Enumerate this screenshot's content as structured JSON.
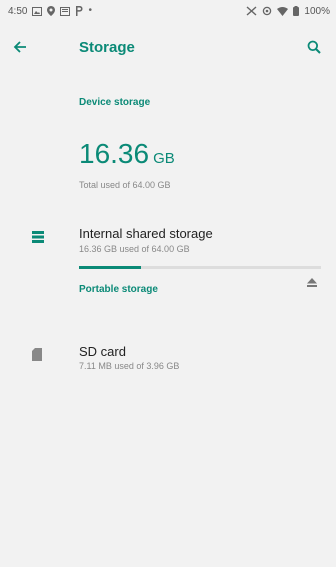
{
  "status_bar": {
    "time": "4:50",
    "battery": "100%"
  },
  "app_bar": {
    "title": "Storage",
    "back_icon": "arrow-left-icon",
    "search_icon": "search-icon"
  },
  "device_storage": {
    "header": "Device storage",
    "used_number": "16.36",
    "used_unit": "GB",
    "total_text": "Total used of 64.00 GB"
  },
  "internal_storage": {
    "title": "Internal shared storage",
    "subtitle": "16.36 GB used of 64.00 GB",
    "used_fraction": 0.2556,
    "icon": "list-icon"
  },
  "portable_storage": {
    "header": "Portable storage",
    "sd_card": {
      "title": "SD card",
      "subtitle": "7.11 MB used of 3.96 GB",
      "icon": "sd-card-icon",
      "eject_icon": "eject-icon"
    }
  },
  "colors": {
    "accent": "#0b8a77",
    "background": "#f2f2f2",
    "track": "#dddddd"
  }
}
